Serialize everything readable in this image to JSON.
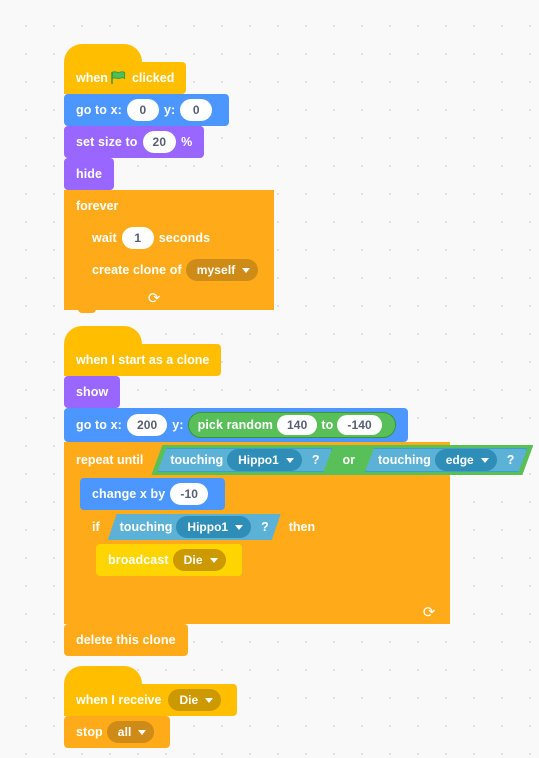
{
  "editor": {
    "background_color": "#f9f9f9",
    "grid_dot_color": "#e3e3e3"
  },
  "palette": {
    "events": "#ffbf00",
    "events_light": "#ffd500",
    "motion": "#4c97ff",
    "looks": "#9966ff",
    "control": "#ffab19",
    "sensing": "#5cb1d6",
    "operators": "#59c059",
    "input_text": "#575e75"
  },
  "scripts": [
    {
      "id": "script-flag-clicked",
      "hat": {
        "prefix": "when",
        "icon": "green-flag-icon",
        "suffix": "clicked"
      },
      "blocks": {
        "goto": {
          "label_x": "go to x:",
          "value_x": "0",
          "label_y": "y:",
          "value_y": "0"
        },
        "setsize": {
          "label": "set size to",
          "value": "20",
          "unit": "%"
        },
        "hide": {
          "label": "hide"
        },
        "forever": {
          "label": "forever"
        },
        "wait": {
          "label": "wait",
          "value": "1",
          "unit": "seconds"
        },
        "createclone": {
          "label": "create clone of",
          "target": "myself"
        }
      }
    },
    {
      "id": "script-start-as-clone",
      "hat": {
        "label": "when I start as a clone"
      },
      "blocks": {
        "show": {
          "label": "show"
        },
        "goto": {
          "label_x": "go to x:",
          "value_x": "200",
          "label_y": "y:",
          "pickrandom": {
            "label": "pick random",
            "from": "140",
            "to_label": "to",
            "to": "-140"
          }
        },
        "repeatuntil": {
          "label": "repeat until",
          "condition": {
            "left": {
              "label": "touching",
              "target": "Hippo1",
              "q": "?"
            },
            "operator": "or",
            "right": {
              "label": "touching",
              "target": "edge",
              "q": "?"
            }
          }
        },
        "changex": {
          "label": "change x by",
          "value": "-10"
        },
        "if": {
          "label": "if",
          "then_label": "then",
          "condition": {
            "label": "touching",
            "target": "Hippo1",
            "q": "?"
          }
        },
        "broadcast": {
          "label": "broadcast",
          "message": "Die"
        },
        "deleteclone": {
          "label": "delete this clone"
        }
      }
    },
    {
      "id": "script-when-receive",
      "hat": {
        "label": "when I receive",
        "message": "Die"
      },
      "blocks": {
        "stop": {
          "label": "stop",
          "option": "all"
        }
      }
    }
  ]
}
